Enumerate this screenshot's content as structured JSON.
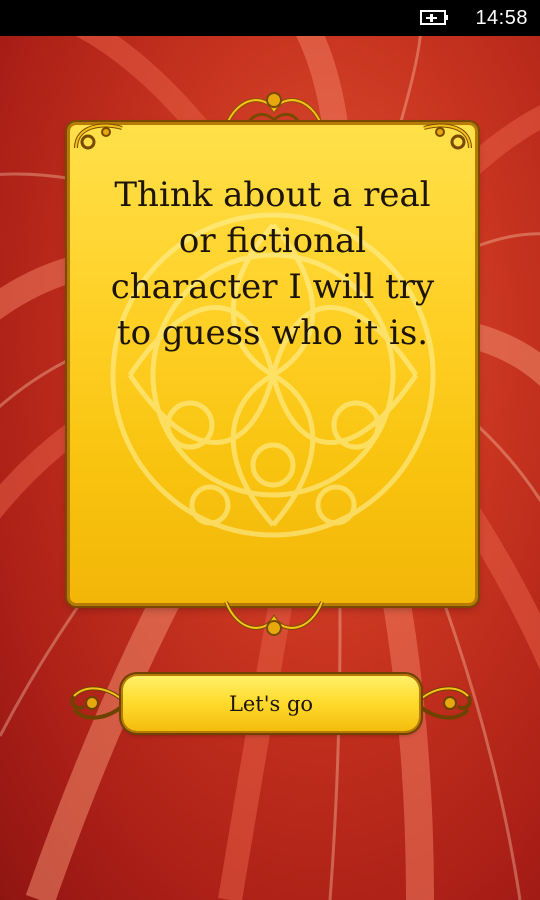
{
  "status_bar": {
    "time": "14:58",
    "battery_icon": "battery-charging-icon"
  },
  "card": {
    "message": "Think about a real or fictional character I will try to guess who it is."
  },
  "actions": {
    "start_label": "Let's go"
  },
  "colors": {
    "background": "#c8341f",
    "card": "#ffd22a",
    "card_border": "#b67a06",
    "text": "#1d1408"
  }
}
